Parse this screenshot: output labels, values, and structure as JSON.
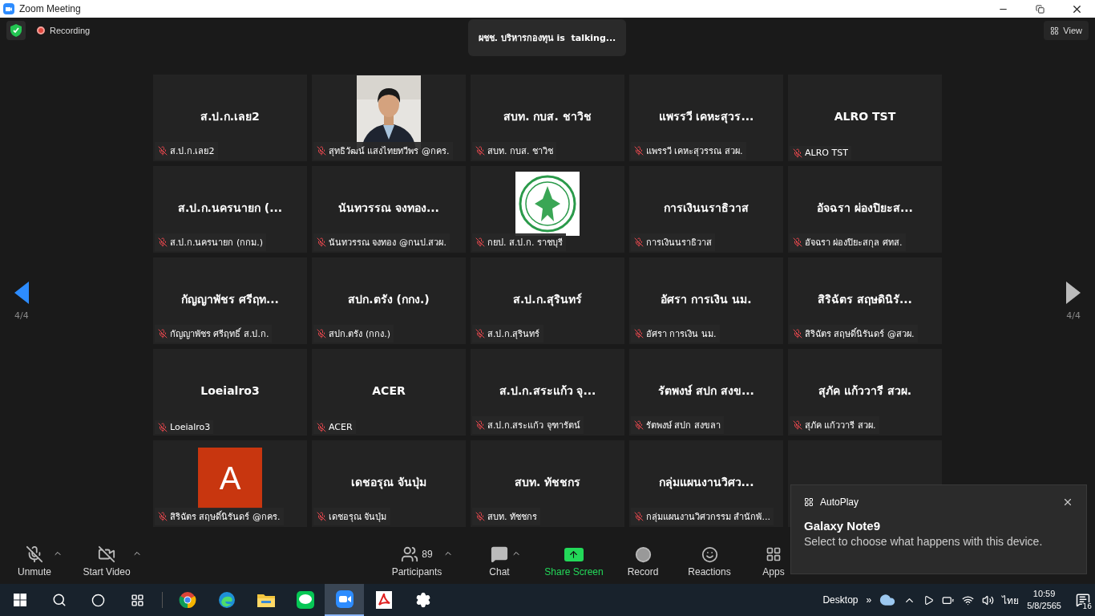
{
  "window": {
    "title": "Zoom Meeting"
  },
  "meeting_bar": {
    "recording": "Recording",
    "talking": "ผชช. บริหารกองทุน is  talking...",
    "view": "View"
  },
  "pager": {
    "left": "4/4",
    "right": "4/4"
  },
  "tiles": [
    {
      "kind": "name",
      "display": "ส.ป.ก.เลย2",
      "label": "ส.ป.ก.เลย2",
      "muted": true
    },
    {
      "label": "สุทธิวัฒน์ แสงไทยทวีพร @กคร.",
      "muted": true
    },
    {
      "kind": "name",
      "display": "สบท. กบส. ชาวิช",
      "label": "สบท. กบส. ชาวิช",
      "muted": true
    },
    {
      "kind": "name",
      "display": "แพรรวี เคหะสุวร...",
      "label": "แพรรวี เคหะสุวรรณ สวผ.",
      "muted": true
    },
    {
      "kind": "name",
      "display": "ALRO TST",
      "label": "ALRO TST",
      "muted": true
    },
    {
      "kind": "name",
      "display": "ส.ป.ก.นครนายก (...",
      "label": "ส.ป.ก.นครนายก (กกม.)",
      "muted": true
    },
    {
      "kind": "name",
      "display": "นันทวรรณ จงทอง...",
      "label": "นันทวรรณ จงทอง @กนป.สวผ.",
      "muted": true
    },
    {
      "kind": "logo",
      "label": "กยป. ส.ป.ก. ราชบุรี",
      "muted": true
    },
    {
      "kind": "name",
      "display": "การเงินนราธิวาส",
      "label": "การเงินนราธิวาส",
      "muted": true
    },
    {
      "kind": "name",
      "display": "อัจฉรา ผ่องปิยะส...",
      "label": "อัจฉรา ผ่องปิยะสกุล ศทส.",
      "muted": true
    },
    {
      "kind": "name",
      "display": "กัญญาพัชร ศรีฤท...",
      "label": "กัญญาพัชร ศรีฤทธิ์ ส.ป.ก.",
      "muted": true
    },
    {
      "kind": "name",
      "display": "สปก.ตรัง (กกง.)",
      "label": "สปก.ตรัง (กกง.)",
      "muted": true
    },
    {
      "kind": "name",
      "display": "ส.ป.ก.สุรินทร์",
      "label": "ส.ป.ก.สุรินทร์",
      "muted": true
    },
    {
      "kind": "name",
      "display": "อัศรา การเงิน นม.",
      "label": "อัศรา การเงิน นม.",
      "muted": true
    },
    {
      "kind": "name",
      "display": "สิริฉัตร สฤษดินิรั...",
      "label": "สิริฉัตร สฤษดิ์นิรันดร์ @สวผ.",
      "muted": true
    },
    {
      "kind": "name",
      "display": "Loeialro3",
      "label": "Loeialro3",
      "muted": true
    },
    {
      "kind": "name",
      "display": "ACER",
      "label": "ACER",
      "muted": true
    },
    {
      "kind": "name",
      "display": "ส.ป.ก.สระแก้ว จุ...",
      "label": "ส.ป.ก.สระแก้ว จุฑารัตน์",
      "muted": true
    },
    {
      "kind": "name",
      "display": "รัตพงษ์  สปก สงข...",
      "label": "รัตพงษ์  สปก สงขลา",
      "muted": true
    },
    {
      "kind": "name",
      "display": "สุภัค แก้ววารี สวผ.",
      "label": "สุภัค แก้ววารี สวผ.",
      "muted": true
    },
    {
      "kind": "avatar",
      "initial": "A",
      "label": "สิริฉัตร สฤษดิ์นิรันดร์ @กคร.",
      "muted": true
    },
    {
      "kind": "name",
      "display": "เดชอรุณ จันปุ่ม",
      "label": "เดชอรุณ จันปุ่ม",
      "muted": true
    },
    {
      "kind": "name",
      "display": "สบท. ทัชชกร",
      "label": "สบท. ทัชชกร",
      "muted": true
    },
    {
      "kind": "name",
      "display": "กลุ่มแผนงานวิศว...",
      "label": "กลุ่มแผนงานวิศวกรรม สำนักพั...",
      "muted": true
    },
    {
      "kind": "covered"
    }
  ],
  "toolbar": [
    {
      "kind": "mic",
      "label": "Unmute",
      "caret": true
    },
    {
      "kind": "video",
      "label": "Start Video",
      "caret": true
    },
    {
      "kind": "participants",
      "label": "Participants",
      "count": "89",
      "caret": true
    },
    {
      "kind": "chat",
      "label": "Chat",
      "caret": true
    },
    {
      "kind": "share",
      "label": "Share Screen",
      "caret": false
    },
    {
      "kind": "record",
      "label": "Record",
      "caret": false
    },
    {
      "kind": "reactions",
      "label": "Reactions",
      "caret": false
    },
    {
      "kind": "apps",
      "label": "Apps",
      "caret": false
    }
  ],
  "notification": {
    "app": "AutoPlay",
    "title": "Galaxy Note9",
    "message": "Select to choose what happens with this device."
  },
  "taskbar": {
    "apps": [
      {
        "kind": "chrome",
        "selected": false
      },
      {
        "kind": "edge",
        "selected": false
      },
      {
        "kind": "folder",
        "selected": false
      },
      {
        "kind": "line",
        "selected": false
      },
      {
        "kind": "zoom",
        "selected": true
      },
      {
        "kind": "pdf",
        "selected": false
      },
      {
        "kind": "settings",
        "selected": false
      }
    ],
    "desktop": "Desktop",
    "more": "»",
    "language": "ไทย",
    "time": "10:59",
    "date": "5/8/2565",
    "notifications": "16"
  }
}
